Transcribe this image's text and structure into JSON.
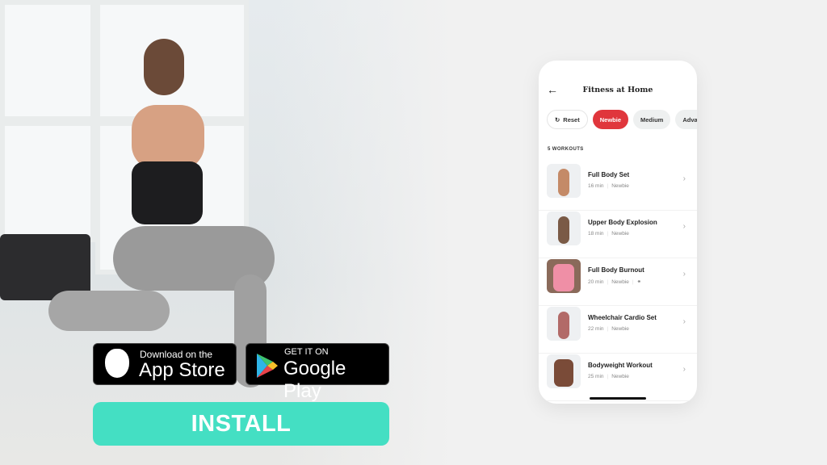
{
  "app": {
    "title": "Fitness at Home",
    "back_icon": "arrow-left-icon"
  },
  "filters": [
    {
      "label": "Reset",
      "icon": "refresh-icon"
    },
    {
      "label": "Newbie",
      "active": true
    },
    {
      "label": "Medium"
    },
    {
      "label": "Advanced"
    }
  ],
  "workout_count": "5 WORKOUTS",
  "workouts": [
    {
      "name": "Full Body Set",
      "duration": "16 min",
      "level": "Newbie"
    },
    {
      "name": "Upper Body Explosion",
      "duration": "18 min",
      "level": "Newbie"
    },
    {
      "name": "Full Body Burnout",
      "duration": "20 min",
      "level": "Newbie",
      "extra_icon": "link-icon"
    },
    {
      "name": "Wheelchair Cardio Set",
      "duration": "22 min",
      "level": "Newbie"
    },
    {
      "name": "Bodyweight Workout",
      "duration": "25 min",
      "level": "Newbie"
    }
  ],
  "badges": {
    "app_store": {
      "small": "Download on the",
      "big": "App Store"
    },
    "google_play": {
      "small": "GET IT ON",
      "big": "Google Play"
    }
  },
  "cta": {
    "label": "INSTALL"
  },
  "colors": {
    "accent": "#e0363c",
    "install": "#44dfc3"
  }
}
